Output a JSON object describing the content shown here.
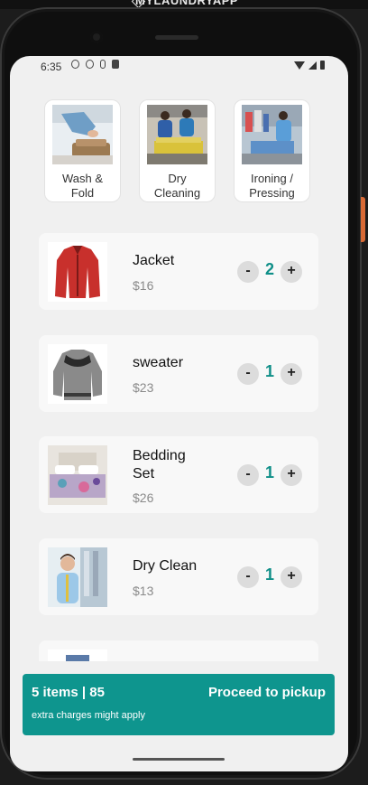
{
  "window": {
    "title": "MYLAUNDRYAPP"
  },
  "status_bar": {
    "time": "6:35"
  },
  "services": [
    {
      "label_line1": "Wash &",
      "label_line2": "Fold"
    },
    {
      "label_line1": "Dry",
      "label_line2": "Cleaning"
    },
    {
      "label_line1": "Ironing /",
      "label_line2": "Pressing"
    }
  ],
  "items": [
    {
      "name": "Jacket",
      "price": "$16",
      "qty": "2"
    },
    {
      "name": "sweater",
      "price": "$23",
      "qty": "1"
    },
    {
      "name": "Bedding Set",
      "price": "$26",
      "qty": "1"
    },
    {
      "name": "Dry Clean",
      "price": "$13",
      "qty": "1"
    }
  ],
  "controls": {
    "minus": "-",
    "plus": "+"
  },
  "cart": {
    "summary": "5 items | 85",
    "action": "Proceed to pickup",
    "note": "extra charges might apply"
  },
  "colors": {
    "accent": "#0e958e",
    "qty_text": "#0f8f88"
  }
}
